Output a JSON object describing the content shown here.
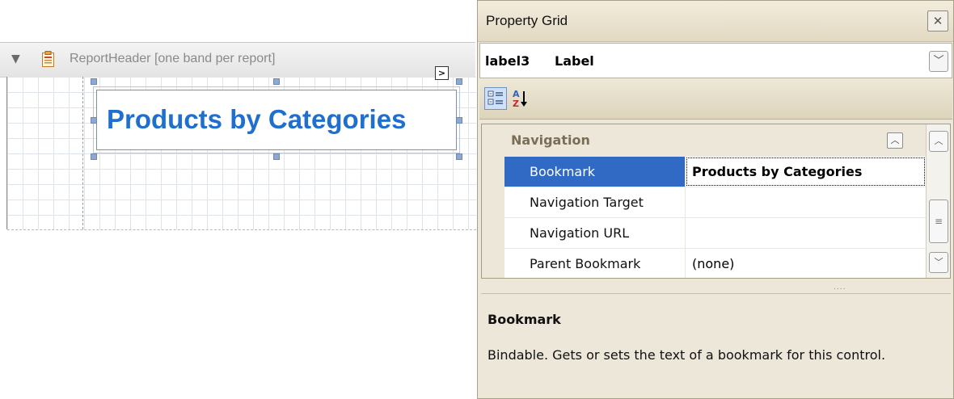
{
  "designer": {
    "band_title": "ReportHeader [one band per report]",
    "smart_tag_glyph": ">",
    "label_text": "Products by Categories"
  },
  "property_grid": {
    "title": "Property Grid",
    "close_glyph": "✕",
    "selected_object": {
      "name": "label3",
      "type": "Label"
    },
    "category": "Navigation",
    "properties": [
      {
        "name": "Bookmark",
        "value": "Products by Categories",
        "selected": true
      },
      {
        "name": "Navigation Target",
        "value": ""
      },
      {
        "name": "Navigation URL",
        "value": ""
      },
      {
        "name": "Parent Bookmark",
        "value": "(none)"
      }
    ],
    "description": {
      "title": "Bookmark",
      "text": "Bindable. Gets or sets the text of a bookmark for this control."
    }
  },
  "icons": [
    "collapse-arrow-icon",
    "report-header-band-icon",
    "smart-tag-icon",
    "close-icon",
    "dropdown-arrow-icon",
    "categorized-view-icon",
    "alphabetical-sort-icon",
    "collapse-category-icon",
    "scroll-up-icon",
    "scroll-thumb-icon",
    "scroll-down-icon"
  ],
  "colors": {
    "label_text": "#1f6fce",
    "selection": "#316ac5",
    "panel": "#ece7d8",
    "category_text": "#7a6e58"
  }
}
